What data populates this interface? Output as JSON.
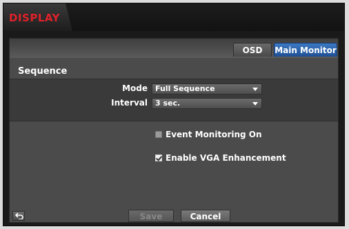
{
  "window": {
    "title": "DISPLAY"
  },
  "tabs": [
    {
      "label": "OSD",
      "active": false
    },
    {
      "label": "Main Monitor",
      "active": true
    }
  ],
  "sequence": {
    "section_label": "Sequence",
    "mode": {
      "label": "Mode",
      "value": "Full Sequence"
    },
    "interval": {
      "label": "Interval",
      "value": "3 sec."
    }
  },
  "options": {
    "event_monitoring": {
      "label": "Event Monitoring On",
      "checked": false
    },
    "vga_enhancement": {
      "label": "Enable VGA Enhancement",
      "checked": true
    }
  },
  "footer": {
    "back_icon": "back-arrow-icon",
    "save_label": "Save",
    "save_enabled": false,
    "cancel_label": "Cancel"
  },
  "colors": {
    "title_red": "#e0212a",
    "active_tab_blue": "#2a63ad"
  }
}
